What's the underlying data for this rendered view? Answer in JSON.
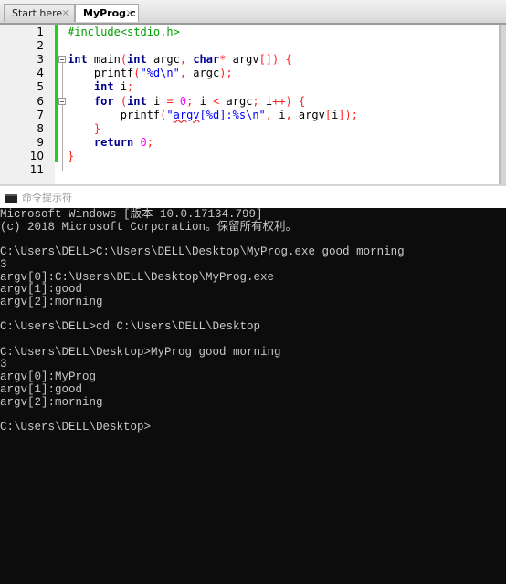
{
  "tabs": [
    {
      "label": "Start here",
      "close": "×"
    },
    {
      "label": "MyProg.c",
      "close": "×"
    }
  ],
  "editor": {
    "lines": [
      {
        "n": "1",
        "tokens": [
          [
            "pp",
            "#include<stdio.h>"
          ]
        ]
      },
      {
        "n": "2",
        "tokens": []
      },
      {
        "n": "3",
        "tokens": [
          [
            "kw",
            "int"
          ],
          [
            "id",
            " main"
          ],
          [
            "pn",
            "("
          ],
          [
            "kw",
            "int"
          ],
          [
            "id",
            " argc"
          ],
          [
            "pn",
            ", "
          ],
          [
            "kw",
            "char"
          ],
          [
            "pn",
            "*"
          ],
          [
            "id",
            " argv"
          ],
          [
            "pn",
            "[]) {"
          ]
        ]
      },
      {
        "n": "4",
        "tokens": [
          [
            "id",
            "    printf"
          ],
          [
            "pn",
            "("
          ],
          [
            "st",
            "\"%d\\n\""
          ],
          [
            "pn",
            ", "
          ],
          [
            "id",
            "argc"
          ],
          [
            "pn",
            ");"
          ]
        ]
      },
      {
        "n": "5",
        "tokens": [
          [
            "id",
            "    "
          ],
          [
            "kw",
            "int"
          ],
          [
            "id",
            " i"
          ],
          [
            "pn",
            ";"
          ]
        ]
      },
      {
        "n": "6",
        "tokens": [
          [
            "id",
            "    "
          ],
          [
            "kw",
            "for"
          ],
          [
            "id",
            " "
          ],
          [
            "pn",
            "("
          ],
          [
            "kw",
            "int"
          ],
          [
            "id",
            " i "
          ],
          [
            "pn",
            "="
          ],
          [
            "id",
            " "
          ],
          [
            "nm",
            "0"
          ],
          [
            "pn",
            ";"
          ],
          [
            "id",
            " i "
          ],
          [
            "pn",
            "<"
          ],
          [
            "id",
            " argc"
          ],
          [
            "pn",
            ";"
          ],
          [
            "id",
            " i"
          ],
          [
            "pn",
            "++) {"
          ]
        ]
      },
      {
        "n": "7",
        "tokens": [
          [
            "id",
            "        printf"
          ],
          [
            "pn",
            "("
          ],
          [
            "st",
            "\""
          ],
          [
            "sq",
            "argv"
          ],
          [
            "st",
            "[%d]:%s\\n\""
          ],
          [
            "pn",
            ", "
          ],
          [
            "id",
            "i"
          ],
          [
            "pn",
            ", "
          ],
          [
            "id",
            "argv"
          ],
          [
            "pn",
            "["
          ],
          [
            "id",
            "i"
          ],
          [
            "pn",
            "]);"
          ]
        ]
      },
      {
        "n": "8",
        "tokens": [
          [
            "id",
            "    "
          ],
          [
            "pn",
            "}"
          ]
        ]
      },
      {
        "n": "9",
        "tokens": [
          [
            "id",
            "    "
          ],
          [
            "kw",
            "return"
          ],
          [
            "id",
            " "
          ],
          [
            "nm",
            "0"
          ],
          [
            "pn",
            ";"
          ]
        ]
      },
      {
        "n": "10",
        "tokens": [
          [
            "pn",
            "}"
          ]
        ]
      },
      {
        "n": "11",
        "tokens": []
      }
    ]
  },
  "cmd": {
    "title": "命令提示符",
    "output": "Microsoft Windows [版本 10.0.17134.799]\n(c) 2018 Microsoft Corporation。保留所有权利。\n\nC:\\Users\\DELL>C:\\Users\\DELL\\Desktop\\MyProg.exe good morning\n3\nargv[0]:C:\\Users\\DELL\\Desktop\\MyProg.exe\nargv[1]:good\nargv[2]:morning\n\nC:\\Users\\DELL>cd C:\\Users\\DELL\\Desktop\n\nC:\\Users\\DELL\\Desktop>MyProg good morning\n3\nargv[0]:MyProg\nargv[1]:good\nargv[2]:morning\n\nC:\\Users\\DELL\\Desktop>"
  }
}
